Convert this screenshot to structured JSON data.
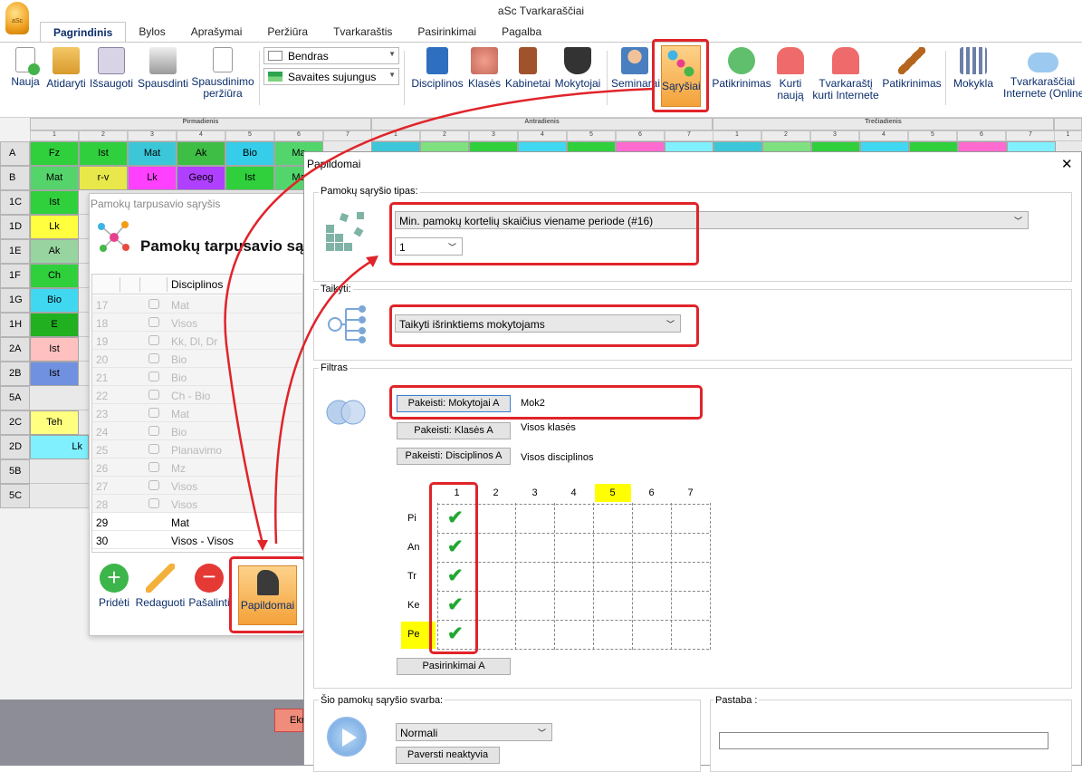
{
  "app": {
    "title": "aSc Tvarkaraščiai",
    "logo_text": "aSc"
  },
  "tabs": [
    "Pagrindinis",
    "Bylos",
    "Aprašymai",
    "Peržiūra",
    "Tvarkaraštis",
    "Pasirinkimai",
    "Pagalba"
  ],
  "ribbon": {
    "nauja": "Nauja",
    "atidaryti": "Atidaryti",
    "issaugoti": "Išsaugoti",
    "spausdinti": "Spausdinti",
    "spausdinimo1": "Spausdinimo",
    "spausdinimo2": "peržiūra",
    "combo_bendras": "Bendras",
    "combo_savaites": "Savaites sujungus",
    "disciplinos": "Disciplinos",
    "klases": "Klasės",
    "kabinetai": "Kabinetai",
    "mokytojai": "Mokytojai",
    "seminarai": "Seminarai",
    "sarysiai": "Sąryšiai",
    "patikrinimas": "Patikrinimas",
    "kurti1": "Kurti",
    "kurti2": "naują",
    "tvark1": "Tvarkaraštį",
    "tvark2": "kurti Internete",
    "patikrinimas2": "Patikrinimas",
    "mokykla": "Mokykla",
    "internetas1": "Tvarkaraščiai",
    "internetas2": "Internete (Online)"
  },
  "days": [
    "Pirmadienis",
    "Antradienis",
    "Trečiadienis"
  ],
  "periods": [
    "1",
    "2",
    "3",
    "4",
    "5",
    "6",
    "7"
  ],
  "rows": [
    "A",
    "B",
    "1C",
    "1D",
    "1E",
    "1F",
    "1G",
    "1H",
    "2A",
    "2B",
    "5A",
    "2C",
    "2D",
    "5B",
    "5C"
  ],
  "cells": {
    "A": [
      "Fz",
      "Ist",
      "Mat",
      "Ak",
      "Bio",
      "Ma"
    ],
    "B": [
      "Mat",
      "r-v",
      "Lk",
      "Geog",
      "Ist",
      "Ma"
    ],
    "1C": "Ist",
    "1D": "Lk",
    "1E": "Ak",
    "1F": "Ch",
    "1G": "Bio",
    "1H": "E",
    "2A": "Ist",
    "2B": "Ist",
    "2C": "Teh",
    "2D": "Lk"
  },
  "constraints_window": {
    "title": "Pamokų tarpusavio sąryšis",
    "heading": "Pamokų tarpusavio sąryšiai",
    "column": "Disciplinos",
    "rows": [
      {
        "n": "17",
        "t": "Mat"
      },
      {
        "n": "18",
        "t": "Visos"
      },
      {
        "n": "19",
        "t": "Kk, Dl, Dr"
      },
      {
        "n": "20",
        "t": "Bio"
      },
      {
        "n": "21",
        "t": "Bio"
      },
      {
        "n": "22",
        "t": "Ch - Bio"
      },
      {
        "n": "23",
        "t": "Mat"
      },
      {
        "n": "24",
        "t": "Bio"
      },
      {
        "n": "25",
        "t": "Planavimo"
      },
      {
        "n": "26",
        "t": "Mz"
      },
      {
        "n": "27",
        "t": "Visos"
      },
      {
        "n": "28",
        "t": "Visos"
      },
      {
        "n": "29",
        "t": "Mat"
      },
      {
        "n": "30",
        "t": "Visos - Visos"
      }
    ],
    "buttons": {
      "add": "Pridėti",
      "edit": "Redaguoti",
      "remove": "Pašalinti",
      "extra": "Papildomai"
    }
  },
  "dialog": {
    "title": "Papildomai",
    "type_label": "Pamokų sąryšio tipas:",
    "type_value": "Min. pamokų kortelių skaičius viename periode (#16)",
    "count_value": "1",
    "apply_label": "Taikyti:",
    "apply_value": "Taikyti išrinktiems mokytojams",
    "filter_label": "Filtras",
    "btn_teachers": "Pakeisti: Mokytojai A",
    "val_teachers": "Mok2",
    "btn_classes": "Pakeisti: Klasės A",
    "val_classes": "Visos klasės",
    "btn_subjects": "Pakeisti: Disciplinos A",
    "val_subjects": "Visos disciplinos",
    "periods": [
      "1",
      "2",
      "3",
      "4",
      "5",
      "6",
      "7"
    ],
    "days": [
      "Pi",
      "An",
      "Tr",
      "Ke",
      "Pe"
    ],
    "btn_options": "Pasirinkimai A",
    "weight_label": "Šio pamokų sąryšio svarba:",
    "weight_value": "Normali",
    "btn_inactive": "Paversti neaktyvia",
    "note_label": "Pastaba :",
    "bottom_btn": "Ekr"
  }
}
